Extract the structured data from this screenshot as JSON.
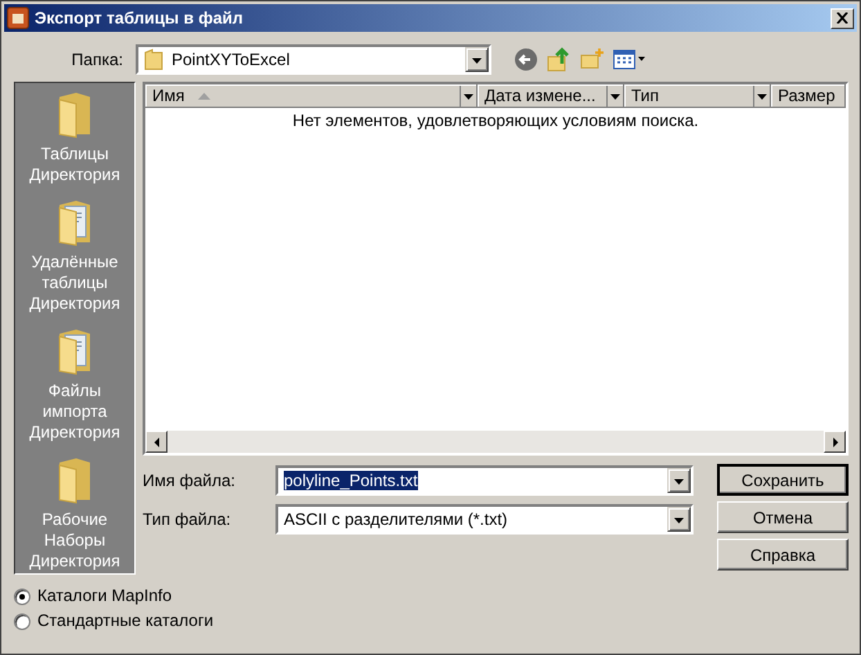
{
  "window": {
    "title": "Экспорт таблицы в файл"
  },
  "location": {
    "label": "Папка:",
    "value": "PointXYToExcel"
  },
  "places": [
    {
      "label": "Таблицы\nДиректория",
      "kind": "folder"
    },
    {
      "label": "Удалённые\nтаблицы\nДиректория",
      "kind": "documents"
    },
    {
      "label": "Файлы\nимпорта\nДиректория",
      "kind": "documents"
    },
    {
      "label": "Рабочие\nНаборы\nДиректория",
      "kind": "folder"
    }
  ],
  "file_list": {
    "columns": [
      {
        "label": "Имя",
        "sorted": true
      },
      {
        "label": "Дата измене..."
      },
      {
        "label": "Тип"
      },
      {
        "label": "Размер"
      }
    ],
    "empty_message": "Нет элементов, удовлетворяющих условиям поиска."
  },
  "file_name": {
    "label": "Имя файла:",
    "value": "polyline_Points.txt",
    "highlighted": true
  },
  "file_type": {
    "label": "Тип файла:",
    "value": "ASCII с разделителями (*.txt)"
  },
  "buttons": [
    {
      "label": "Сохранить",
      "default": true
    },
    {
      "label": "Отмена",
      "default": false
    },
    {
      "label": "Справка",
      "default": false
    }
  ],
  "directory_options": [
    {
      "label": "Каталоги MapInfo",
      "selected": true
    },
    {
      "label": "Стандартные каталоги",
      "selected": false
    }
  ]
}
